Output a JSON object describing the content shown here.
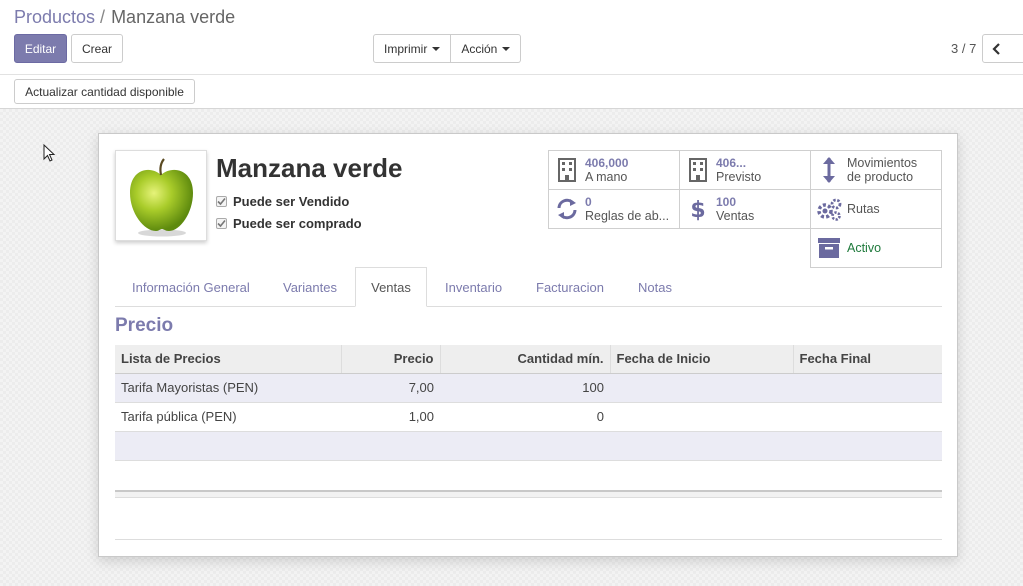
{
  "breadcrumb": {
    "parent": "Productos",
    "separator": "/",
    "current": "Manzana verde"
  },
  "toolbar": {
    "edit_label": "Editar",
    "create_label": "Crear",
    "print_label": "Imprimir",
    "action_label": "Acción"
  },
  "pager": {
    "value": "3 / 7"
  },
  "statusbar": {
    "update_qty_label": "Actualizar cantidad disponible"
  },
  "product": {
    "name": "Manzana verde",
    "can_be_sold": "Puede ser Vendido",
    "can_be_purchased": "Puede ser comprado"
  },
  "smart_buttons": {
    "on_hand": {
      "value": "406,000",
      "label": "A mano"
    },
    "forecast": {
      "value": "406...",
      "label": "Previsto"
    },
    "moves": {
      "line1": "Movimientos",
      "line2": "de producto"
    },
    "reorder": {
      "value": "0",
      "label": "Reglas de ab..."
    },
    "sales": {
      "value": "100",
      "label": "Ventas"
    },
    "routes": {
      "label": "Rutas"
    },
    "active": {
      "label": "Activo"
    }
  },
  "tabs": [
    "Información General",
    "Variantes",
    "Ventas",
    "Inventario",
    "Facturacion",
    "Notas"
  ],
  "pricing": {
    "title": "Precio",
    "columns": [
      "Lista de Precios",
      "Precio",
      "Cantidad mín.",
      "Fecha de Inicio",
      "Fecha Final"
    ],
    "rows": [
      {
        "pricelist": "Tarifa Mayoristas (PEN)",
        "price": "7,00",
        "min_qty": "100",
        "start": "",
        "end": ""
      },
      {
        "pricelist": "Tarifa pública (PEN)",
        "price": "1,00",
        "min_qty": "0",
        "start": "",
        "end": ""
      }
    ]
  },
  "colors": {
    "brand": "#7c7bad",
    "active_green": "#1f7a3c"
  }
}
